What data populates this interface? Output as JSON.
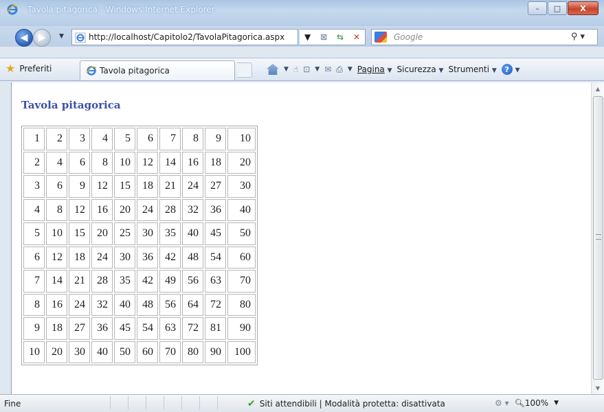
{
  "window": {
    "title": "Tavola pitagorica - Windows Internet Explorer",
    "controls": {
      "minimize": "–",
      "maximize": "□",
      "close": "X"
    }
  },
  "addressbar": {
    "url": "http://localhost/Capitolo2/TavolaPitagorica.aspx",
    "search_placeholder": "Google",
    "search_icon": "magnifier-icon"
  },
  "favorites": {
    "label": "Preferiti"
  },
  "tab": {
    "label": "Tavola pitagorica"
  },
  "commandbar": {
    "pagina": "Pagina",
    "sicurezza": "Sicurezza",
    "strumenti": "Strumenti"
  },
  "page": {
    "title": "Tavola pitagorica",
    "table": [
      [
        "1",
        "2",
        "3",
        "4",
        "5",
        "6",
        "7",
        "8",
        "9",
        "10"
      ],
      [
        "2",
        "4",
        "6",
        "8",
        "10",
        "12",
        "14",
        "16",
        "18",
        "20"
      ],
      [
        "3",
        "6",
        "9",
        "12",
        "15",
        "18",
        "21",
        "24",
        "27",
        "30"
      ],
      [
        "4",
        "8",
        "12",
        "16",
        "20",
        "24",
        "28",
        "32",
        "36",
        "40"
      ],
      [
        "5",
        "10",
        "15",
        "20",
        "25",
        "30",
        "35",
        "40",
        "45",
        "50"
      ],
      [
        "6",
        "12",
        "18",
        "24",
        "30",
        "36",
        "42",
        "48",
        "54",
        "60"
      ],
      [
        "7",
        "14",
        "21",
        "28",
        "35",
        "42",
        "49",
        "56",
        "63",
        "70"
      ],
      [
        "8",
        "16",
        "24",
        "32",
        "40",
        "48",
        "56",
        "64",
        "72",
        "80"
      ],
      [
        "9",
        "18",
        "27",
        "36",
        "45",
        "54",
        "63",
        "72",
        "81",
        "90"
      ],
      [
        "10",
        "20",
        "30",
        "40",
        "50",
        "60",
        "70",
        "80",
        "90",
        "100"
      ]
    ]
  },
  "statusbar": {
    "status": "Fine",
    "zone": "Siti attendibili | Modalità protetta: disattivata",
    "zoom": "100%"
  },
  "colors": {
    "title_blue": "#3d4ea3",
    "chrome_blue": "#c6d9ee"
  }
}
